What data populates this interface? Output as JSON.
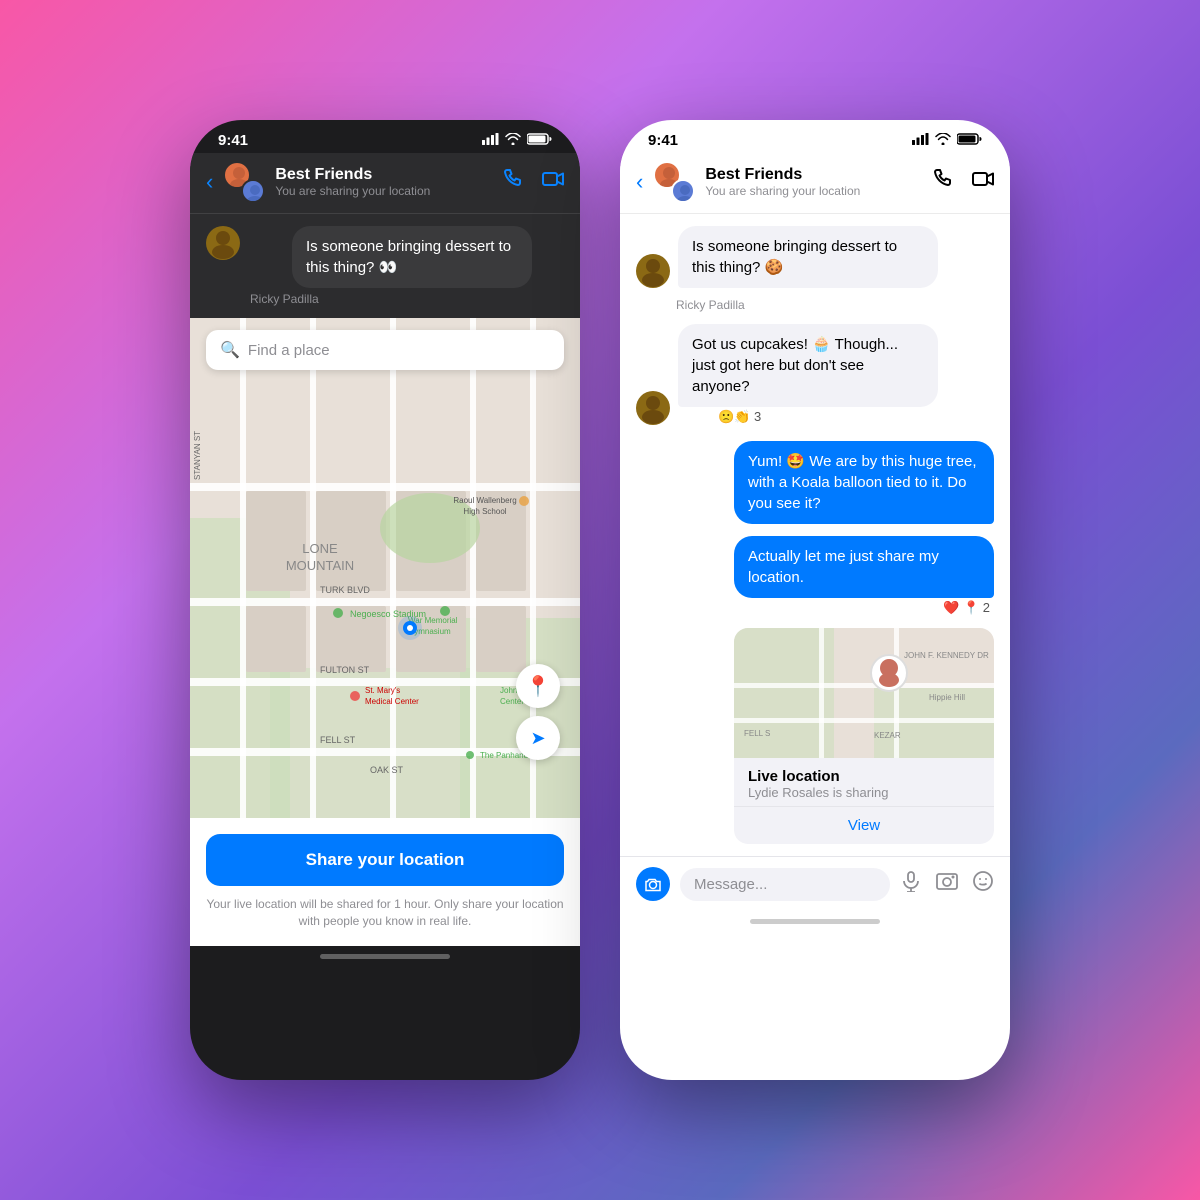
{
  "background": "gradient",
  "left_phone": {
    "type": "dark",
    "status_bar": {
      "time": "9:41",
      "signal": "●●●●",
      "wifi": "wifi",
      "battery": "battery"
    },
    "header": {
      "title": "Best Friends",
      "subtitle": "You are sharing your location",
      "back": "<",
      "call_icon": "phone",
      "video_icon": "video"
    },
    "prev_message": {
      "text": "Is someone bringing dessert to this thing? 👀",
      "sender": "Ricky Padilla"
    },
    "map": {
      "find_placeholder": "Find a place",
      "search_icon": "🔍",
      "location_btn_icon": "📍",
      "navigate_btn_icon": "➤",
      "user_dot": "blue dot",
      "labels": [
        "Raoul Wallenberg High School",
        "Negoesco Stadium",
        "War Memorial Gymnasium",
        "St. Mary's Medical Center",
        "John Adams Center",
        "The Panhandle",
        "LONE MOUNTAIN"
      ],
      "streets": [
        "TURK BLVD",
        "FULTON ST",
        "FELL ST",
        "OAK ST"
      ]
    },
    "share_button": {
      "label": "Share your location"
    },
    "disclaimer": "Your live location will be shared for 1 hour. Only share your location with people you know in real life."
  },
  "right_phone": {
    "type": "light",
    "status_bar": {
      "time": "9:41",
      "signal": "●●●●",
      "wifi": "wifi",
      "battery": "battery"
    },
    "header": {
      "title": "Best Friends",
      "subtitle": "You are sharing your location",
      "back": "<",
      "call_icon": "phone",
      "video_icon": "video"
    },
    "messages": [
      {
        "id": "msg1",
        "type": "received",
        "text": "Is someone bringing dessert to this thing? 🍪",
        "sender": "Ricky Padilla",
        "has_avatar": true
      },
      {
        "id": "msg2",
        "type": "received",
        "text": "Got us cupcakes! 🧁 Though... just got here but don't see anyone?",
        "reactions": "🙁👏 3",
        "has_avatar": true
      },
      {
        "id": "msg3",
        "type": "sent",
        "text": "Yum! 🤩 We are by this huge tree, with a Koala balloon tied to it. Do you see it?"
      },
      {
        "id": "msg4",
        "type": "sent",
        "text": "Actually let me just share my location.",
        "reactions": "❤️ 📍 2"
      },
      {
        "id": "msg5",
        "type": "location_card",
        "live_location_title": "Live location",
        "live_location_sub": "Lydie Rosales is sharing",
        "view_btn": "View"
      }
    ],
    "input_bar": {
      "placeholder": "Message...",
      "camera_icon": "📷",
      "mic_icon": "🎤",
      "photo_icon": "🖼",
      "sticker_icon": "😊"
    }
  }
}
